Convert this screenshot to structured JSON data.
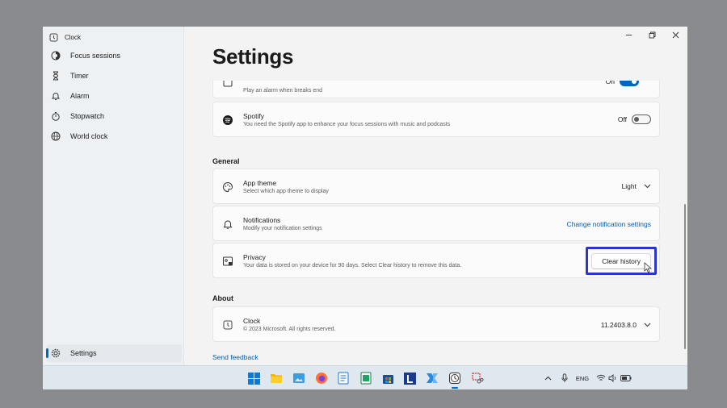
{
  "app": {
    "title": "Clock"
  },
  "sidebar": {
    "items": [
      {
        "label": "Focus sessions",
        "icon": "focus-icon"
      },
      {
        "label": "Timer",
        "icon": "hourglass-icon"
      },
      {
        "label": "Alarm",
        "icon": "bell-icon"
      },
      {
        "label": "Stopwatch",
        "icon": "stopwatch-icon"
      },
      {
        "label": "World clock",
        "icon": "globe-icon"
      }
    ],
    "settings_label": "Settings"
  },
  "page": {
    "title": "Settings"
  },
  "focus": {
    "break_alarm": {
      "subtitle": "Play an alarm when breaks end",
      "state": "On"
    },
    "spotify": {
      "title": "Spotify",
      "subtitle": "You need the Spotify app to enhance your focus sessions with music and podcasts",
      "state": "Off"
    }
  },
  "general": {
    "heading": "General",
    "app_theme": {
      "title": "App theme",
      "subtitle": "Select which app theme to display",
      "value": "Light"
    },
    "notifications": {
      "title": "Notifications",
      "subtitle": "Modify your notification settings",
      "link": "Change notification settings"
    },
    "privacy": {
      "title": "Privacy",
      "subtitle": "Your data is stored on your device for 90 days. Select Clear history to remove this data.",
      "button": "Clear history"
    }
  },
  "about": {
    "heading": "About",
    "app": {
      "title": "Clock",
      "subtitle": "© 2023 Microsoft. All rights reserved.",
      "version": "11.2403.8.0"
    },
    "feedback": "Send feedback"
  },
  "taskbar": {
    "apps": [
      "start-icon",
      "file-explorer-icon",
      "photos-icon",
      "firefox-icon",
      "notepad-icon",
      "excel-icon",
      "store-icon",
      "l-app-icon",
      "power-automate-icon",
      "clock-app-icon",
      "snipping-tool-icon"
    ],
    "language": "ENG"
  },
  "colors": {
    "accent": "#0067c0",
    "highlight": "#2a35c9"
  }
}
